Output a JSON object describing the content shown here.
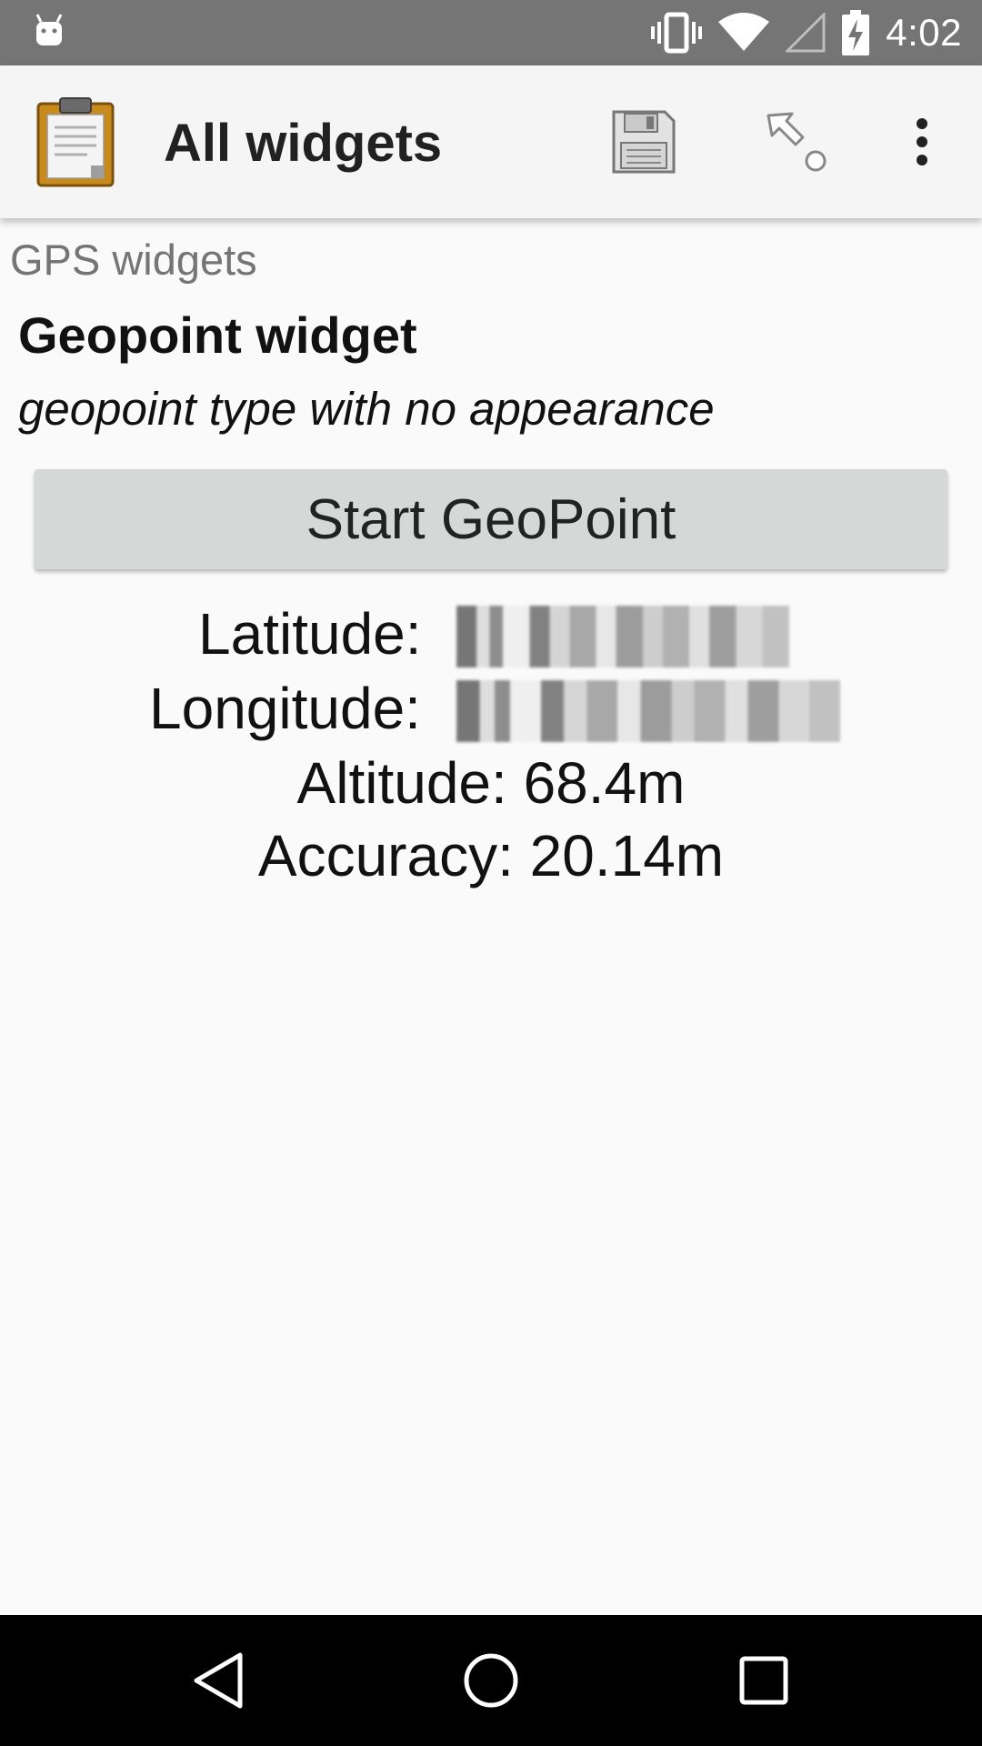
{
  "status_bar": {
    "time": "4:02",
    "icons": [
      "android-notification-icon",
      "vibrate-icon",
      "wifi-icon",
      "signal-icon",
      "battery-charging-icon"
    ]
  },
  "toolbar": {
    "title": "All widgets",
    "app_icon": "clipboard-form-icon",
    "save_icon": "save-floppy-icon",
    "goto_icon": "jump-to-question-icon",
    "menu_icon": "more-vertical-icon"
  },
  "form": {
    "group_label": "GPS widgets",
    "question_label": "Geopoint widget",
    "hint": "geopoint type with no appearance",
    "start_button_label": "Start GeoPoint",
    "latitude_label": "Latitude:",
    "longitude_label": "Longitude:",
    "altitude_text": "Altitude: 68.4m",
    "accuracy_text": "Accuracy: 20.14m"
  },
  "nav_bar": {
    "icons": [
      "back-icon",
      "home-icon",
      "recents-icon"
    ]
  },
  "colors": {
    "status_bar": "#757575",
    "toolbar": "#f5f5f5",
    "background": "#fafafa",
    "button": "#d6d7d7",
    "nav_bar": "#000000"
  }
}
